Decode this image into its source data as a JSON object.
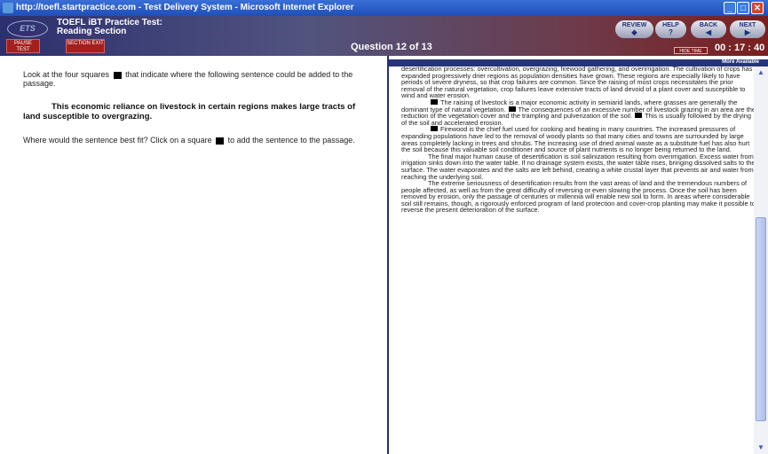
{
  "window": {
    "title": "http://toefl.startpractice.com - Test Delivery System - Microsoft Internet Explorer"
  },
  "header": {
    "logo_text": "ETS",
    "test_title": "TOEFL iBT Practice Test:",
    "section_name": "Reading Section",
    "pause_label": "PAUSE TEST",
    "exit_label": "SECTION EXIT",
    "question_counter": "Question 12 of 13",
    "nav": {
      "review": "REVIEW",
      "help": "HELP",
      "back": "BACK",
      "next": "NEXT"
    },
    "hide_time": "HIDE TIME",
    "timer": "00 : 17 : 40"
  },
  "question": {
    "instruction_before": "Look at the four squares",
    "instruction_after": "that indicate where the following sentence could be added to the passage.",
    "sentence": "This economic reliance on livestock in certain regions makes large tracts of land susceptible to overgrazing.",
    "prompt_before": "Where would the sentence best fit? Click on a square",
    "prompt_after": "to add the sentence to the passage."
  },
  "passage": {
    "more_available": "More Available",
    "p1": "desertification processes: overcultivation, overgrazing, firewood gathering, and overirrigation. The cultivation of crops has expanded progressively drier regions as population densities have grown. These regions are especially likely to have periods of severe dryness, so that crop failures are common. Since the raising of most crops necessitates the prior removal of the natural vegetation, crop failures leave extensive tracts of land devoid of a plant cover and susceptible to wind and water erosion.",
    "p2a": "The raising of livestock is a major economic activity in semiarid lands, where grasses are generally the dominant type of natural vegetation.",
    "p2b": "The consequences of an excessive number of livestock grazing in an area are the reduction of the vegetation cover and the trampling and pulverization of the soil.",
    "p2c": "This is usually followed by the drying of the soil and accelerated erosion.",
    "p3": "Firewood is the chief fuel used for cooking and heating in many countries. The increased pressures of expanding populations have led to the removal of woody plants so that many cities and towns are surrounded by large areas completely lacking in trees and shrubs. The increasing use of dried animal waste as a substitute fuel has also hurt the soil because this valuable soil conditioner and source of plant nutrients is no longer being returned to the land.",
    "p4": "The final major human cause of desertification is soil salinization resulting from overirrigation. Excess water from irrigation sinks down into the water table. If no drainage system exists, the water table rises, bringing dissolved salts to the surface. The water evaporates and the salts are left behind, creating a white crustal layer that prevents air and water from reaching the underlying soil.",
    "p5": "The extreme seriousness of desertification results from the vast areas of land and the tremendous numbers of people affected, as well as from the great difficulty of reversing or even slowing the process. Once the soil has been removed by erosion, only the passage of centuries or millennia will enable new soil to form. In areas where considerable soil still remains, though, a rigorously enforced program of land protection and cover-crop planting may make it possible to reverse the present deterioration of the surface."
  },
  "colors": {
    "header_left": "#2d2f6e",
    "header_right": "#7a1f1f",
    "button_red": "#a3201f",
    "divider": "#243070"
  }
}
